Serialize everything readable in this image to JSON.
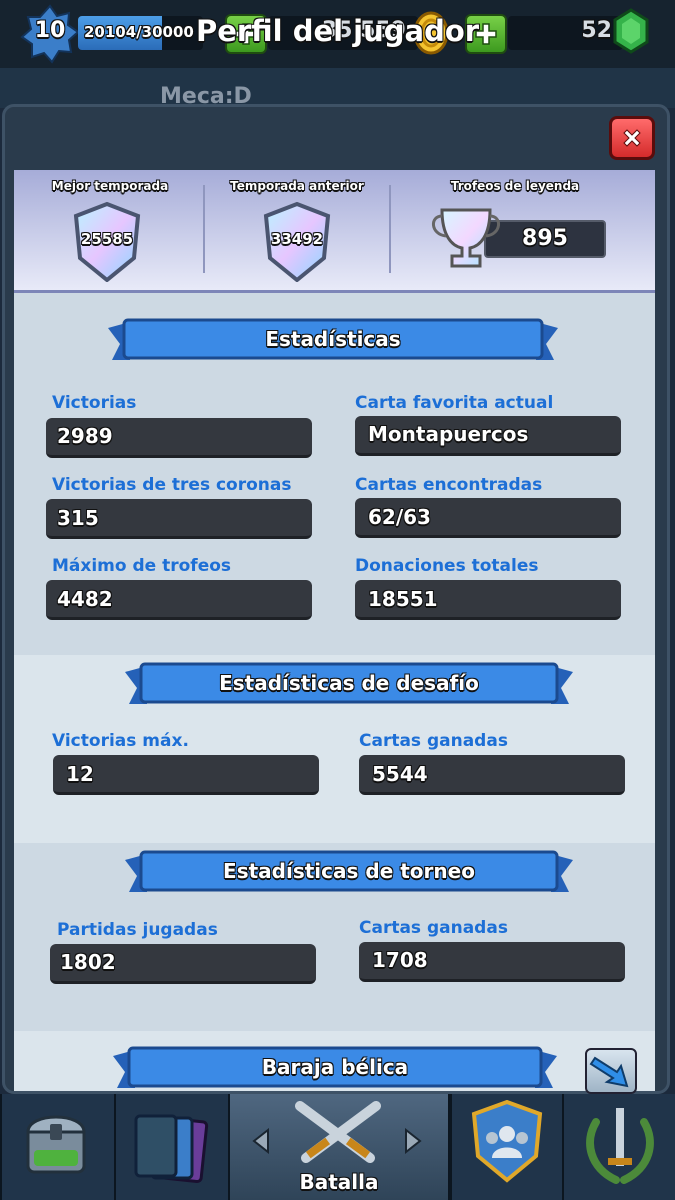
{
  "topbar": {
    "level": "10",
    "xp": "20104/30000",
    "xp_progress": 0.67,
    "gold": "35 559",
    "gems": "52",
    "colors": {
      "gold": "#e8b21c",
      "gem": "#2fa84a",
      "plus": "#56b832"
    }
  },
  "behind": {
    "name": "Meca:D"
  },
  "modal": {
    "title": "Perfil del jugador",
    "close_icon": "close-x-icon"
  },
  "trophies": {
    "best_season_label": "Mejor temporada",
    "best_season_value": "25585",
    "previous_season_label": "Temporada anterior",
    "previous_season_value": "33492",
    "legend_trophies_label": "Trofeos de leyenda",
    "legend_trophies_value": "895"
  },
  "stats": {
    "title": "Estadísticas",
    "items": [
      {
        "label": "Victorias",
        "value": "2989"
      },
      {
        "label": "Carta favorita actual",
        "value": "Montapuercos"
      },
      {
        "label": "Victorias de tres coronas",
        "value": "315"
      },
      {
        "label": "Cartas encontradas",
        "value": "62/63"
      },
      {
        "label": "Máximo de trofeos",
        "value": "4482"
      },
      {
        "label": "Donaciones totales",
        "value": "18551"
      }
    ]
  },
  "challenge": {
    "title": "Estadísticas de desafío",
    "items": [
      {
        "label": "Victorias máx.",
        "value": "12"
      },
      {
        "label": "Cartas ganadas",
        "value": "5544"
      }
    ]
  },
  "tournament": {
    "title": "Estadísticas de torneo",
    "items": [
      {
        "label": "Partidas jugadas",
        "value": "1802"
      },
      {
        "label": "Cartas ganadas",
        "value": "1708"
      }
    ]
  },
  "deck": {
    "title": "Baraja bélica"
  },
  "nav": {
    "battle_label": "Batalla"
  }
}
